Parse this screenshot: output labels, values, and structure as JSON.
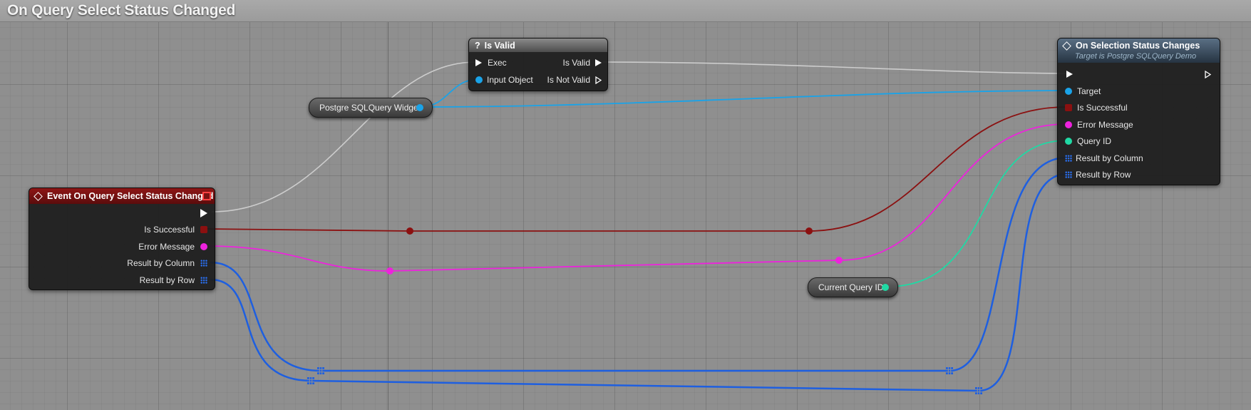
{
  "graph": {
    "title": "On Query Select Status Changed"
  },
  "nodes": {
    "event": {
      "title": "Event On Query Select Status Changed",
      "pins": [
        "Is Successful",
        "Error Message",
        "Result by Column",
        "Result by Row"
      ],
      "header_color": "#7a1212"
    },
    "is_valid": {
      "title": "Is Valid",
      "title_icon": "?",
      "input_exec": "Exec",
      "input_object": "Input Object",
      "output_valid": "Is Valid",
      "output_not_valid": "Is Not Valid"
    },
    "on_selection": {
      "title": "On Selection Status Changes",
      "subtitle": "Target is Postgre SQLQuery Demo",
      "pins": [
        "Target",
        "Is Successful",
        "Error Message",
        "Query ID",
        "Result by Column",
        "Result by Row"
      ],
      "header_color": "#3b4a5a"
    },
    "postgre_widget": {
      "label": "Postgre SQLQuery Widget"
    },
    "current_query": {
      "label": "Current Query ID"
    }
  },
  "colors": {
    "exec": "#ffffff",
    "object": "#1aa3e8",
    "bool": "#8b1010",
    "string": "#ee22dd",
    "query_id": "#20d9a4",
    "array": "#1e5fe0"
  }
}
